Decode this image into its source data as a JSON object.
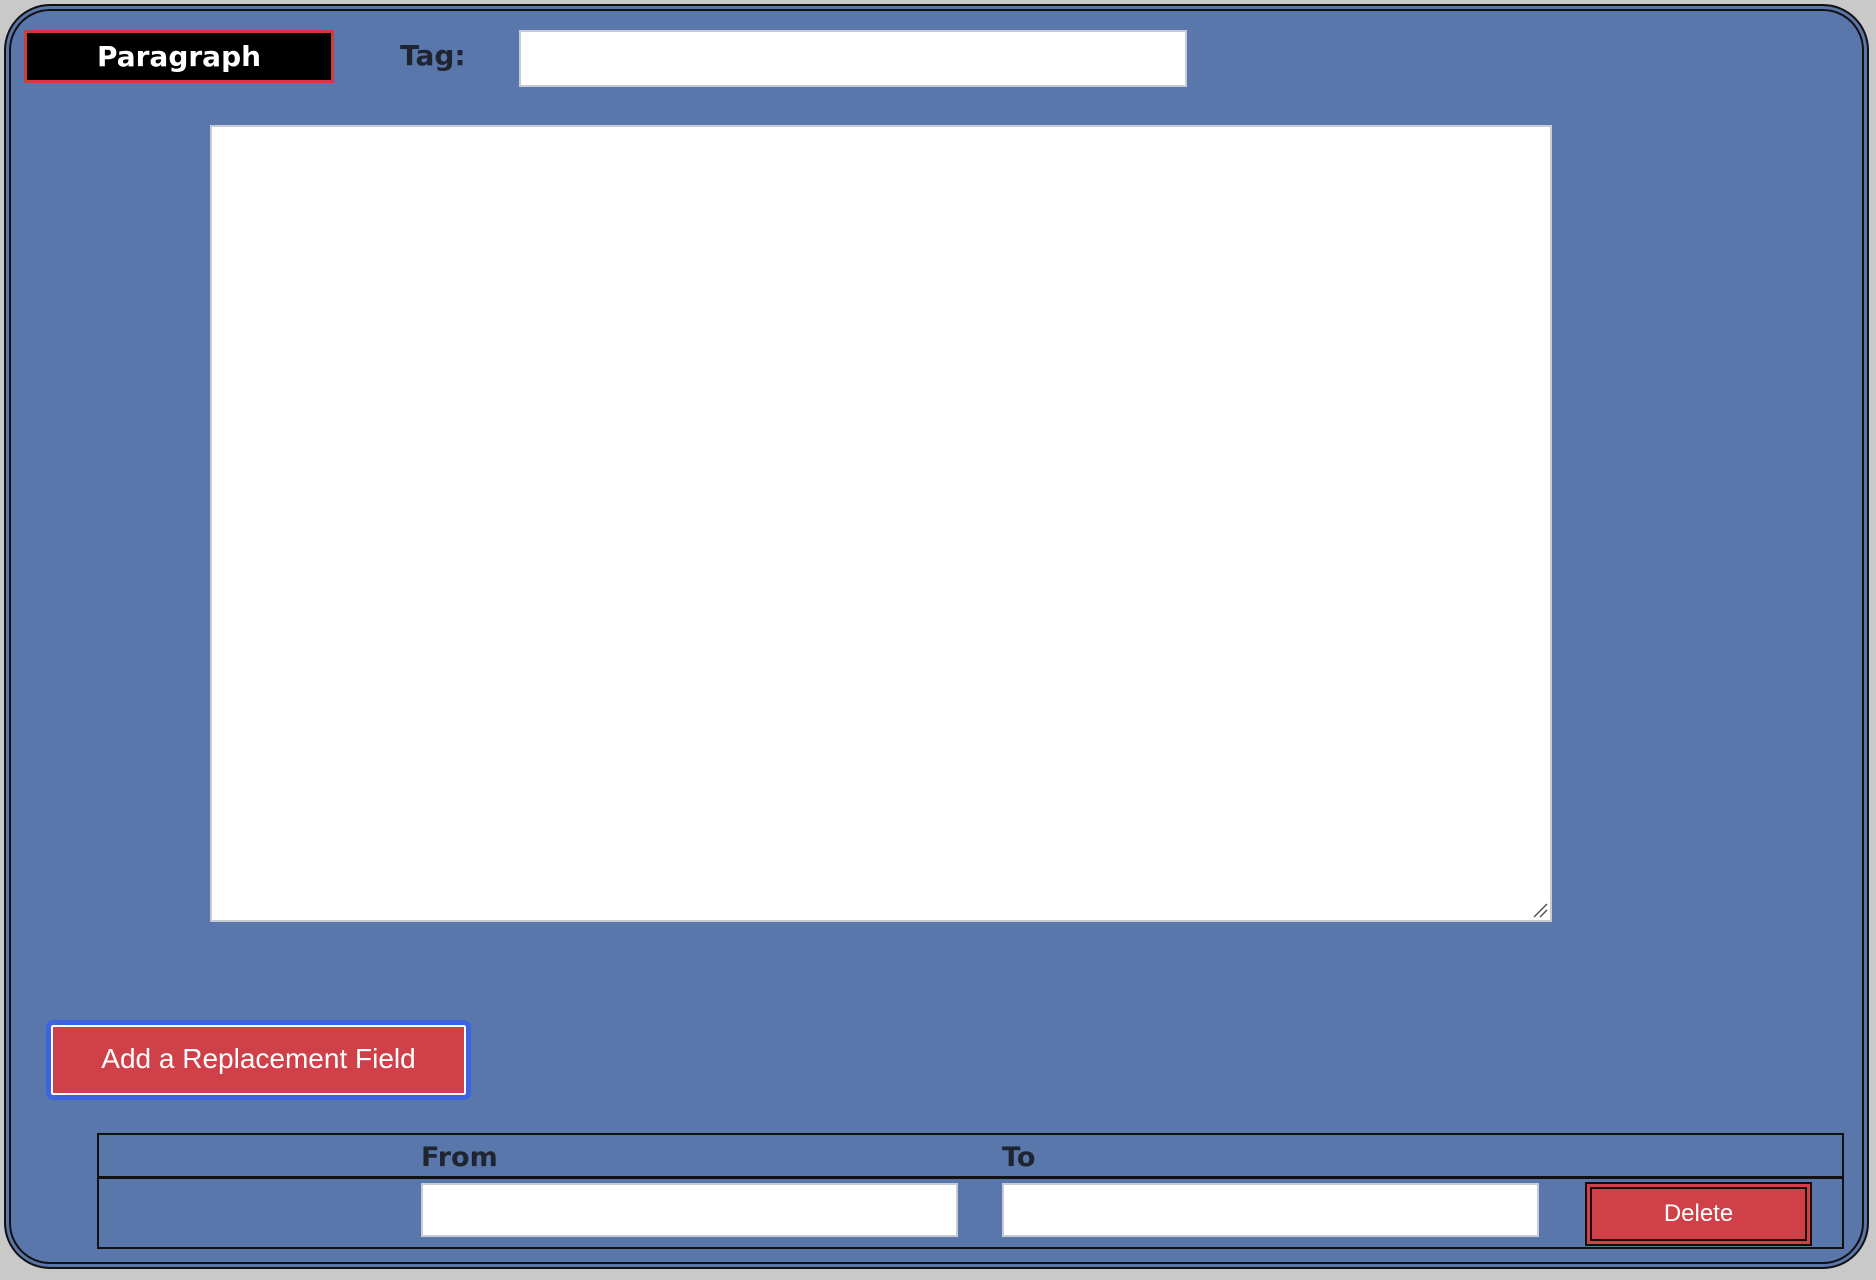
{
  "block": {
    "type_label": "Paragraph",
    "tag_label": "Tag:",
    "tag_value": "",
    "body_text": ""
  },
  "actions": {
    "add_replacement_label": "Add a Replacement Field"
  },
  "replacements": {
    "headers": {
      "from": "From",
      "to": "To"
    },
    "rows": [
      {
        "from_value": "",
        "to_value": "",
        "delete_label": "Delete"
      }
    ]
  },
  "colors": {
    "panel_background": "#5977aa",
    "accent_red": "#cf4049",
    "badge_background": "#000000",
    "focus_ring": "#3d63e0"
  },
  "icons": {
    "textarea_resize": "resize-grip-icon"
  }
}
